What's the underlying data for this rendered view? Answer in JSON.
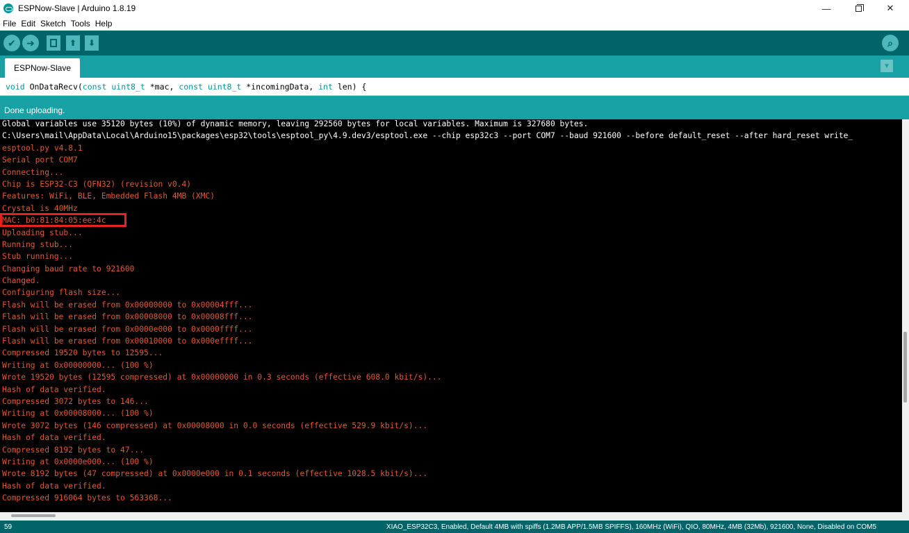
{
  "window": {
    "title": "ESPNow-Slave | Arduino 1.8.19",
    "minimize_glyph": "—",
    "close_glyph": "✕"
  },
  "menu": [
    "File",
    "Edit",
    "Sketch",
    "Tools",
    "Help"
  ],
  "toolbar": {
    "verify_glyph": "✔",
    "upload_glyph": "➜",
    "open_glyph": "⬆",
    "save_glyph": "⬇",
    "serial_glyph": "⌕",
    "icons": [
      "check-icon",
      "arrow-right-icon",
      "page-icon",
      "arrow-up-icon",
      "arrow-down-icon",
      "magnifier-icon"
    ]
  },
  "tab": {
    "name": "ESPNow-Slave",
    "menu_glyph": "▼"
  },
  "editor": {
    "line_tokens": [
      {
        "t": "void",
        "kw": true
      },
      {
        "t": " OnDataRecv(",
        "kw": false
      },
      {
        "t": "const",
        "kw": true
      },
      {
        "t": " ",
        "kw": false
      },
      {
        "t": "uint8_t",
        "kw": true
      },
      {
        "t": " *mac, ",
        "kw": false
      },
      {
        "t": "const",
        "kw": true
      },
      {
        "t": " ",
        "kw": false
      },
      {
        "t": "uint8_t",
        "kw": true
      },
      {
        "t": " *incomingData, ",
        "kw": false
      },
      {
        "t": "int",
        "kw": true
      },
      {
        "t": " len) {",
        "kw": false
      }
    ]
  },
  "status": {
    "message": "Done uploading."
  },
  "console": {
    "lines": [
      {
        "text": "Global variables use 35120 bytes (10%) of dynamic memory, leaving 292560 bytes for local variables. Maximum is 327680 bytes.",
        "color": "white"
      },
      {
        "text": "C:\\Users\\mail\\AppData\\Local\\Arduino15\\packages\\esp32\\tools\\esptool_py\\4.9.dev3/esptool.exe --chip esp32c3 --port COM7 --baud 921600 --before default_reset --after hard_reset write_",
        "color": "white"
      },
      {
        "text": "esptool.py v4.8.1",
        "color": "orange"
      },
      {
        "text": "Serial port COM7",
        "color": "orange"
      },
      {
        "text": "Connecting...",
        "color": "orange"
      },
      {
        "text": "Chip is ESP32-C3 (QFN32) (revision v0.4)",
        "color": "orange"
      },
      {
        "text": "Features: WiFi, BLE, Embedded Flash 4MB (XMC)",
        "color": "orange"
      },
      {
        "text": "Crystal is 40MHz",
        "color": "orange"
      },
      {
        "text": "MAC: b0:81:84:05:ee:4c",
        "color": "orange"
      },
      {
        "text": "Uploading stub...",
        "color": "orange"
      },
      {
        "text": "Running stub...",
        "color": "orange"
      },
      {
        "text": "Stub running...",
        "color": "orange"
      },
      {
        "text": "Changing baud rate to 921600",
        "color": "orange"
      },
      {
        "text": "Changed.",
        "color": "orange"
      },
      {
        "text": "Configuring flash size...",
        "color": "orange"
      },
      {
        "text": "Flash will be erased from 0x00000000 to 0x00004fff...",
        "color": "orange"
      },
      {
        "text": "Flash will be erased from 0x00008000 to 0x00008fff...",
        "color": "orange"
      },
      {
        "text": "Flash will be erased from 0x0000e000 to 0x0000ffff...",
        "color": "orange"
      },
      {
        "text": "Flash will be erased from 0x00010000 to 0x000effff...",
        "color": "orange"
      },
      {
        "text": "Compressed 19520 bytes to 12595...",
        "color": "orange"
      },
      {
        "text": "Writing at 0x00000000... (100 %)",
        "color": "orange"
      },
      {
        "text": "Wrote 19520 bytes (12595 compressed) at 0x00000000 in 0.3 seconds (effective 608.0 kbit/s)...",
        "color": "orange"
      },
      {
        "text": "Hash of data verified.",
        "color": "orange"
      },
      {
        "text": "Compressed 3072 bytes to 146...",
        "color": "orange"
      },
      {
        "text": "Writing at 0x00008000... (100 %)",
        "color": "orange"
      },
      {
        "text": "Wrote 3072 bytes (146 compressed) at 0x00008000 in 0.0 seconds (effective 529.9 kbit/s)...",
        "color": "orange"
      },
      {
        "text": "Hash of data verified.",
        "color": "orange"
      },
      {
        "text": "Compressed 8192 bytes to 47...",
        "color": "orange"
      },
      {
        "text": "Writing at 0x0000e000... (100 %)",
        "color": "orange"
      },
      {
        "text": "Wrote 8192 bytes (47 compressed) at 0x0000e000 in 0.1 seconds (effective 1028.5 kbit/s)...",
        "color": "orange"
      },
      {
        "text": "Hash of data verified.",
        "color": "orange"
      },
      {
        "text": "Compressed 916064 bytes to 563368...",
        "color": "orange"
      }
    ]
  },
  "footer": {
    "line_number": "59",
    "board_info": "XIAO_ESP32C3, Enabled, Default 4MB with spiffs (1.2MB APP/1.5MB SPIFFS), 160MHz (WiFi), QIO, 80MHz, 4MB (32Mb), 921600, None, Disabled on COM5"
  },
  "colors": {
    "toolbar": "#006468",
    "tabbar": "#17a1a5",
    "console_bg": "#000000",
    "console_text": "#e05a33",
    "highlight": "#e8231f"
  }
}
